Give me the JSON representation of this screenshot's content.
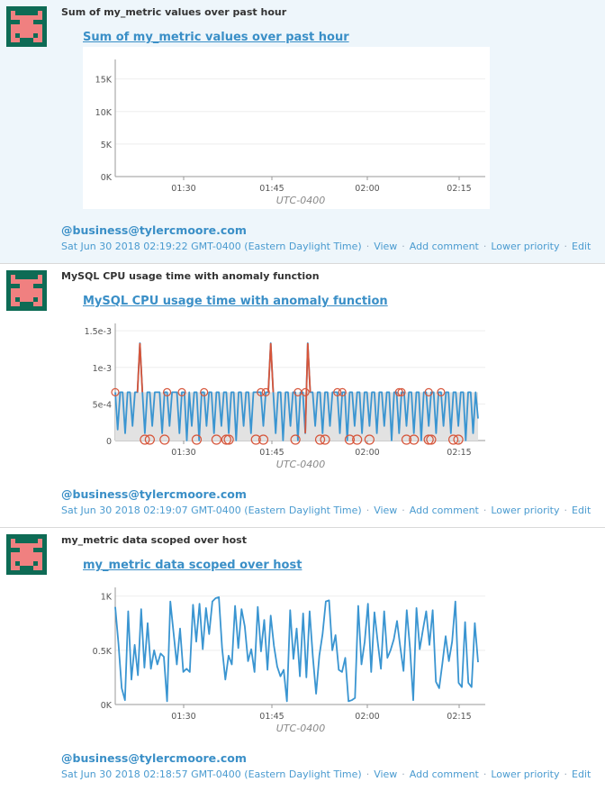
{
  "colors": {
    "link": "#3a8fc7",
    "series": "#3a95d1",
    "anomaly": "#d6553a",
    "band": "#e2e2e2",
    "avatar_bg": "#0e6b55",
    "avatar_fg": "#f08080"
  },
  "events": [
    {
      "title": "Sum of my_metric values over past hour",
      "graph_title": "Sum of my_metric values over past hour",
      "author": "@business@tylercmoore.com",
      "timestamp": "Sat Jun 30 2018 02:19:22 GMT-0400 (Eastern Daylight Time)",
      "actions": [
        "View",
        "Add comment",
        "Lower priority",
        "Edit"
      ]
    },
    {
      "title": "MySQL CPU usage time with anomaly function",
      "graph_title": "MySQL CPU usage time with anomaly function",
      "author": "@business@tylercmoore.com",
      "timestamp": "Sat Jun 30 2018 02:19:07 GMT-0400 (Eastern Daylight Time)",
      "actions": [
        "View",
        "Add comment",
        "Lower priority",
        "Edit"
      ]
    },
    {
      "title": "my_metric data scoped over host",
      "graph_title": "my_metric data scoped over host",
      "author": "@business@tylercmoore.com",
      "timestamp": "Sat Jun 30 2018 02:18:57 GMT-0400 (Eastern Daylight Time)",
      "actions": [
        "View",
        "Add comment",
        "Lower priority",
        "Edit"
      ]
    }
  ],
  "chart_data": [
    {
      "type": "line",
      "x_ticks": [
        "01:30",
        "01:45",
        "02:00",
        "02:15"
      ],
      "y_ticks": [
        "0K",
        "5K",
        "10K",
        "15K"
      ],
      "ylim": [
        0,
        18000
      ],
      "xlabel": "UTC-0400",
      "series": [
        {
          "values": []
        }
      ]
    },
    {
      "type": "line",
      "x_ticks": [
        "01:30",
        "01:45",
        "02:00",
        "02:15"
      ],
      "y_ticks": [
        "0",
        "5e-4",
        "1e-3",
        "1.5e-3"
      ],
      "ylim": [
        0,
        0.0016
      ],
      "xlabel": "UTC-0400",
      "band": [
        0,
        0.00066
      ],
      "series": [
        {
          "values": [
            0.00066,
            0.00015,
            0.00066,
            0.00066,
            0.0001,
            0.00066,
            0.00066,
            0.0002,
            0.00066,
            0.00066,
            0.00133,
            0.00066,
            0.0001,
            0.00066,
            0.00066,
            0.0002,
            0.00066,
            0.00066,
            0.00066,
            0.0001,
            0.00066,
            0.00066,
            0.0002,
            0.00066,
            0.00066,
            0.00066,
            0.0001,
            0.00066,
            0.00066,
            0,
            0.00066,
            0.0002,
            0.00066,
            0.00066,
            0,
            0.00066,
            0.00066,
            0.0002,
            0.00066,
            0.00066,
            0.0001,
            0.00066,
            0.00066,
            0.0002,
            0.00066,
            0.00066,
            0.0001,
            0.00066,
            0.00066,
            0,
            0.00066,
            0.00066,
            0.0002,
            0.00066,
            0.00066,
            0.0001,
            0.00066,
            0.00066,
            0.00066,
            0.00066,
            0.0002,
            0.00066,
            0.00066,
            0.00133,
            0.00066,
            0.0001,
            0.00066,
            0.00066,
            0,
            0.00066,
            0.00066,
            0.0002,
            0.00066,
            0.00066,
            0,
            0.00066,
            0.00066,
            0.0001,
            0.00133,
            0.00066,
            0.00066,
            0.0002,
            0.00066,
            0.00066,
            0.0001,
            0.00066,
            0.00066,
            0.0002,
            0.00066,
            0.00066,
            0.00066,
            0.0001,
            0.00066,
            0.00066,
            0,
            0.00066,
            0.00066,
            0.0002,
            0.00066,
            0.00066,
            0.0001,
            0.00066,
            0.00066,
            0.0002,
            0.00066,
            0.00066,
            0.0001,
            0.00066,
            0.00066,
            0.0002,
            0.00066,
            0.00066,
            0,
            0.00066,
            0.00066,
            0.0001,
            0.00066,
            0.00066,
            0.0002,
            0.00066,
            0.00066,
            0.0001,
            0.00066,
            0.00066,
            0,
            0.00066,
            0.00066,
            0.0002,
            0.00066,
            0.00066,
            0.0001,
            0.00066,
            0.00066,
            0.0002,
            0.00066,
            0.00066,
            0.0001,
            0.00066,
            0.00066,
            0.0002,
            0.00066,
            0.00066,
            0,
            0.00066,
            0.00066,
            0.0001,
            0.00066,
            0.0003
          ]
        }
      ],
      "anomalies_high_index": [
        0,
        21,
        27,
        36,
        59,
        61,
        74,
        77,
        90,
        92,
        115,
        116,
        127,
        132
      ],
      "anomalies_low_index": [
        12,
        14,
        20,
        33,
        41,
        45,
        46,
        57,
        60,
        73,
        83,
        85,
        95,
        98,
        103,
        118,
        121,
        127,
        128,
        137,
        139
      ],
      "spikes_index": [
        10,
        63,
        78
      ]
    },
    {
      "type": "line",
      "x_ticks": [
        "01:30",
        "01:45",
        "02:00",
        "02:15"
      ],
      "y_ticks": [
        "0K",
        "0.5K",
        "1K"
      ],
      "ylim": [
        0,
        1080
      ],
      "xlabel": "UTC-0400",
      "series": [
        {
          "values": [
            900,
            560,
            150,
            40,
            860,
            230,
            550,
            270,
            880,
            340,
            750,
            330,
            500,
            370,
            470,
            440,
            30,
            950,
            660,
            370,
            700,
            300,
            330,
            300,
            920,
            580,
            930,
            510,
            890,
            650,
            950,
            980,
            990,
            520,
            230,
            450,
            370,
            910,
            520,
            880,
            720,
            400,
            510,
            300,
            900,
            490,
            780,
            320,
            820,
            540,
            350,
            260,
            320,
            30,
            870,
            420,
            700,
            260,
            840,
            250,
            860,
            440,
            100,
            450,
            650,
            950,
            960,
            500,
            640,
            320,
            300,
            430,
            30,
            40,
            60,
            910,
            370,
            580,
            930,
            300,
            850,
            580,
            330,
            860,
            430,
            500,
            600,
            770,
            530,
            310,
            870,
            520,
            40,
            890,
            510,
            690,
            860,
            550,
            870,
            210,
            150,
            380,
            630,
            400,
            580,
            950,
            200,
            160,
            760,
            200,
            160,
            750,
            390
          ]
        }
      ]
    }
  ]
}
